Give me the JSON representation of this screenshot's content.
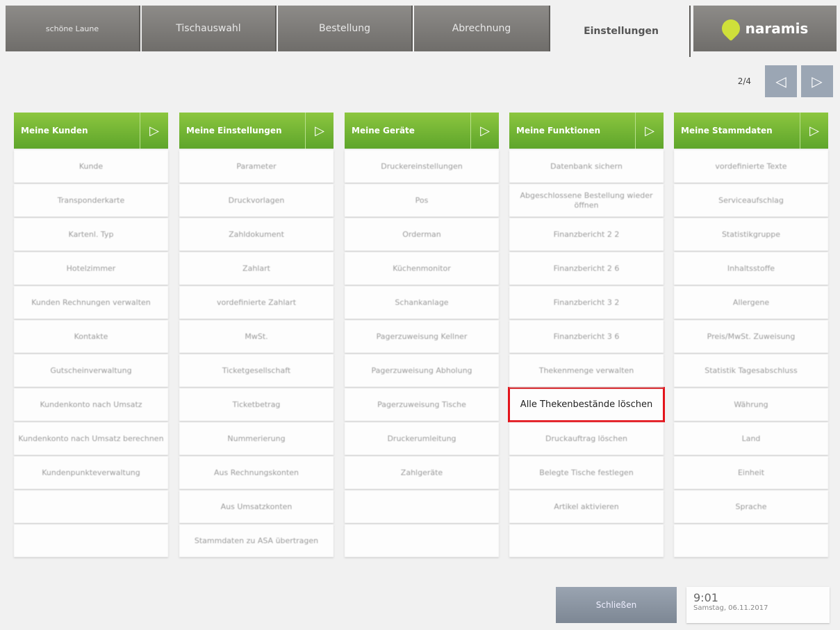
{
  "tabs": [
    {
      "label": "schöne Laune"
    },
    {
      "label": "Tischauswahl"
    },
    {
      "label": "Bestellung"
    },
    {
      "label": "Abrechnung"
    },
    {
      "label": "Einstellungen"
    }
  ],
  "brand": {
    "name": "naramis"
  },
  "pager": {
    "indicator": "2/4"
  },
  "columns": [
    {
      "title": "Meine Kunden",
      "items": [
        "Kunde",
        "Transponderkarte",
        "Kartenl. Typ",
        "Hotelzimmer",
        "Kunden Rechnungen verwalten",
        "Kontakte",
        "Gutscheinverwaltung",
        "Kundenkonto nach Umsatz",
        "Kundenkonto nach Umsatz berechnen",
        "Kundenpunkteverwaltung",
        "",
        ""
      ]
    },
    {
      "title": "Meine Einstellungen",
      "items": [
        "Parameter",
        "Druckvorlagen",
        "Zahldokument",
        "Zahlart",
        "vordefinierte Zahlart",
        "MwSt.",
        "Ticketgesellschaft",
        "Ticketbetrag",
        "Nummerierung",
        "Aus Rechnungskonten",
        "Aus Umsatzkonten",
        "Stammdaten zu ASA übertragen"
      ]
    },
    {
      "title": "Meine Geräte",
      "items": [
        "Druckereinstellungen",
        "Pos",
        "Orderman",
        "Küchenmonitor",
        "Schankanlage",
        "Pagerzuweisung Kellner",
        "Pagerzuweisung Abholung",
        "Pagerzuweisung Tische",
        "Druckerumleitung",
        "Zahlgeräte",
        "",
        ""
      ]
    },
    {
      "title": "Meine Funktionen",
      "items": [
        "Datenbank sichern",
        "Abgeschlossene Bestellung wieder öffnen",
        "Finanzbericht 2 2",
        "Finanzbericht 2 6",
        "Finanzbericht 3 2",
        "Finanzbericht 3 6",
        "Thekenmenge verwalten",
        "Alle Thekenbestände löschen",
        "Druckauftrag löschen",
        "Belegte Tische festlegen",
        "Artikel aktivieren",
        ""
      ]
    },
    {
      "title": "Meine Stammdaten",
      "items": [
        "vordefinierte Texte",
        "Serviceaufschlag",
        "Statistikgruppe",
        "Inhaltsstoffe",
        "Allergene",
        "Preis/MwSt. Zuweisung",
        "Statistik Tagesabschluss",
        "Währung",
        "Land",
        "Einheit",
        "Sprache",
        ""
      ]
    }
  ],
  "footer": {
    "close_label": "Schließen",
    "time": "9:01",
    "date": "Samstag, 06.11.2017"
  }
}
